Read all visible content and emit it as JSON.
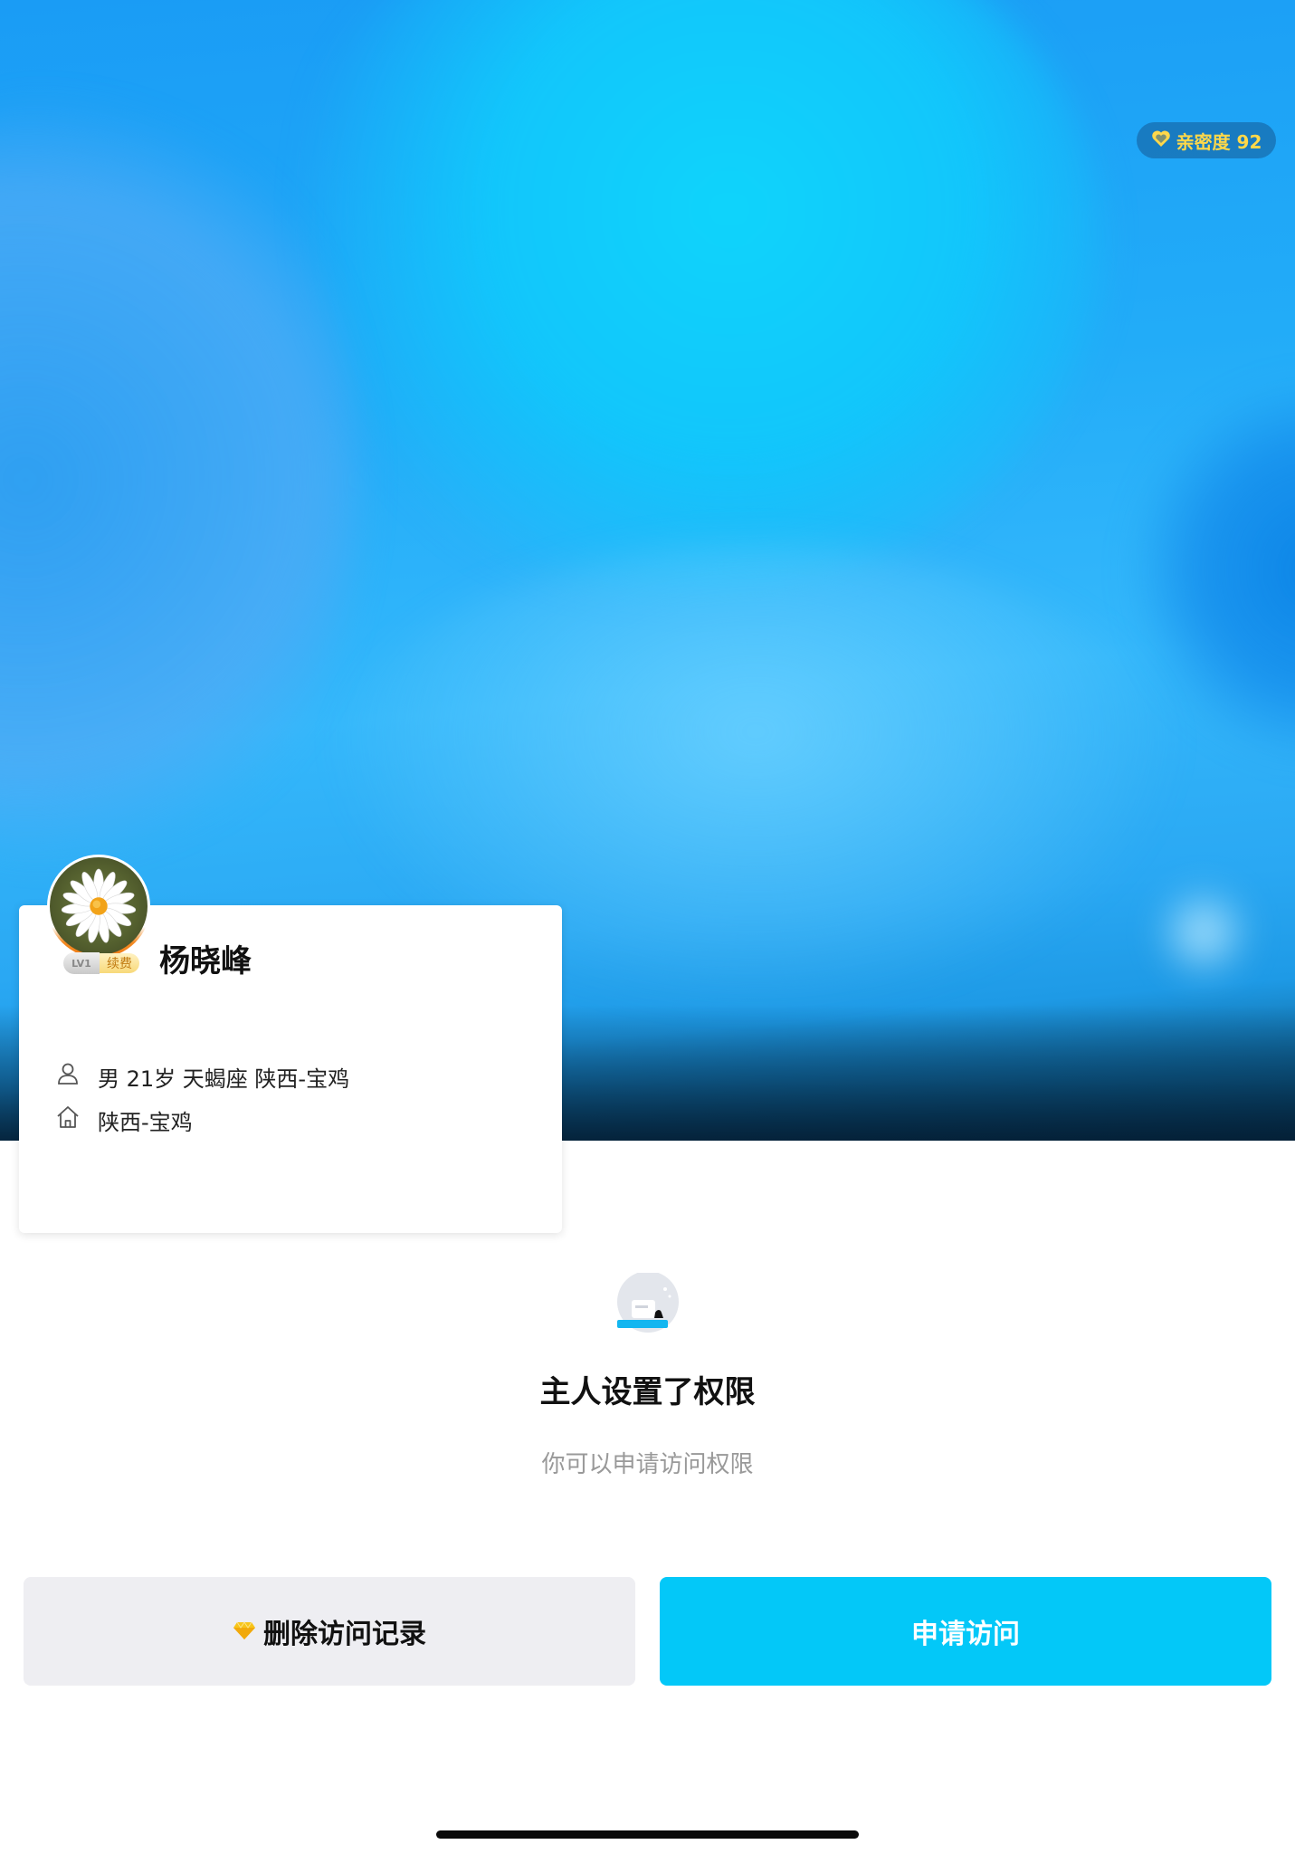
{
  "header": {
    "intimacy": {
      "icon": "heart-icon",
      "label": "亲密度 92"
    }
  },
  "profile": {
    "name": "杨晓峰",
    "vip": {
      "level_label": "LV1",
      "renew_label": "续费"
    },
    "basic_info": "男 21岁 天蝎座 陕西-宝鸡",
    "hometown": "陕西-宝鸡",
    "icons": {
      "basic_info": "person-icon",
      "hometown": "home-icon"
    }
  },
  "permission": {
    "title": "主人设置了权限",
    "subtitle": "你可以申请访问权限"
  },
  "actions": {
    "delete_label": "删除访问记录",
    "delete_icon": "diamond-icon",
    "apply_label": "申请访问"
  },
  "colors": {
    "accent": "#03c8f8",
    "intimacy_text": "#ffd84a",
    "vip_ring": "#ef7a14"
  }
}
